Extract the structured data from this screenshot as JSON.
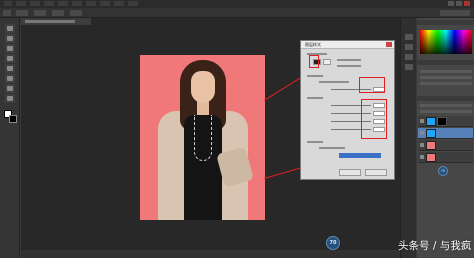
{
  "dialog": {
    "title": "图层样式"
  },
  "watermark": {
    "text": "头条号 / 与我疯"
  },
  "badges": {
    "main": "70",
    "panel": "70"
  },
  "colors": {
    "photo_background": "#f07878",
    "highlight_red": "#e02020",
    "selection_blue": "#3b72c8",
    "layer_active": "#5580b8"
  },
  "icons": {
    "toolbox": [
      "move-icon",
      "marquee-icon",
      "lasso-icon",
      "quick-select-icon",
      "crop-icon",
      "eyedropper-icon",
      "healing-icon",
      "brush-icon"
    ],
    "dialog_close": "close-icon"
  }
}
